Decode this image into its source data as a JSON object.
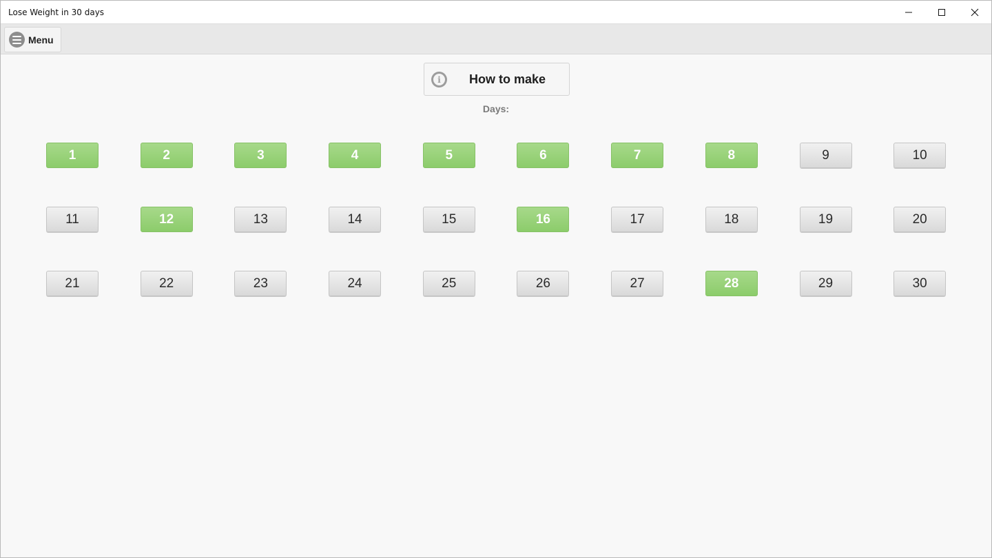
{
  "window": {
    "title": "Lose Weight in 30 days",
    "controls": [
      "minimize-icon",
      "maximize-icon",
      "close-icon"
    ]
  },
  "toolbar": {
    "menu_label": "Menu",
    "menu_icon": "hamburger-icon"
  },
  "main": {
    "how_to_label": "How to make",
    "how_to_icon": "info-icon",
    "days_label": "Days:"
  },
  "days": [
    {
      "label": "1",
      "completed": true
    },
    {
      "label": "2",
      "completed": true
    },
    {
      "label": "3",
      "completed": true
    },
    {
      "label": "4",
      "completed": true
    },
    {
      "label": "5",
      "completed": true
    },
    {
      "label": "6",
      "completed": true
    },
    {
      "label": "7",
      "completed": true
    },
    {
      "label": "8",
      "completed": true
    },
    {
      "label": "9",
      "completed": false
    },
    {
      "label": "10",
      "completed": false
    },
    {
      "label": "11",
      "completed": false
    },
    {
      "label": "12",
      "completed": true
    },
    {
      "label": "13",
      "completed": false
    },
    {
      "label": "14",
      "completed": false
    },
    {
      "label": "15",
      "completed": false
    },
    {
      "label": "16",
      "completed": true
    },
    {
      "label": "17",
      "completed": false
    },
    {
      "label": "18",
      "completed": false
    },
    {
      "label": "19",
      "completed": false
    },
    {
      "label": "20",
      "completed": false
    },
    {
      "label": "21",
      "completed": false
    },
    {
      "label": "22",
      "completed": false
    },
    {
      "label": "23",
      "completed": false
    },
    {
      "label": "24",
      "completed": false
    },
    {
      "label": "25",
      "completed": false
    },
    {
      "label": "26",
      "completed": false
    },
    {
      "label": "27",
      "completed": false
    },
    {
      "label": "28",
      "completed": true
    },
    {
      "label": "29",
      "completed": false
    },
    {
      "label": "30",
      "completed": false
    }
  ],
  "colors": {
    "completed_day": "#8ccc6b",
    "pending_day": "#dcdcdc",
    "background": "#f8f8f8"
  }
}
